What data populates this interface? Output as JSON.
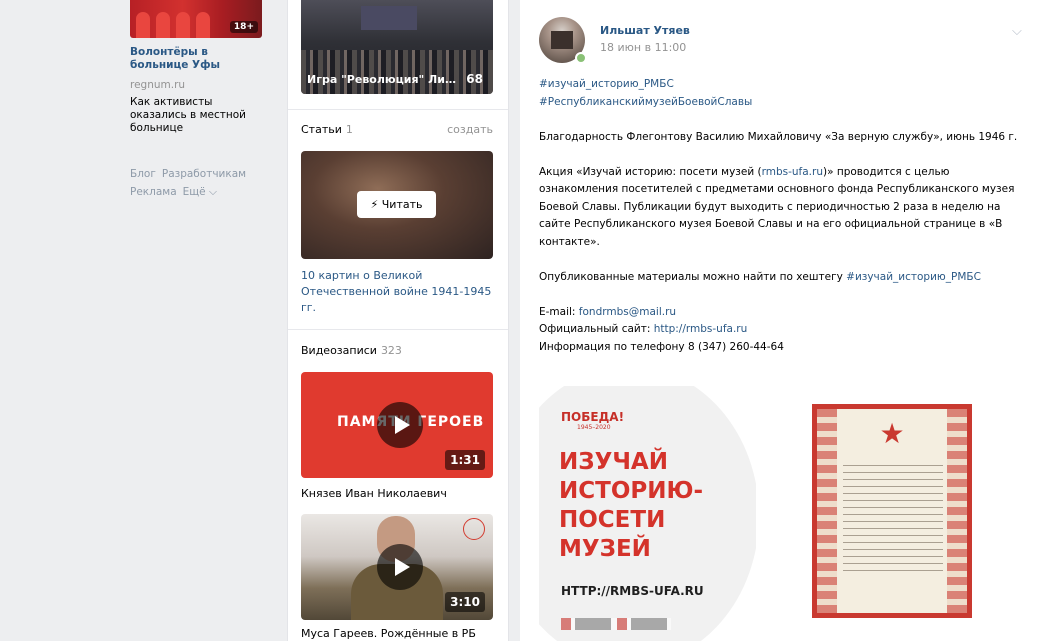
{
  "left": {
    "ad": {
      "badge": "18+",
      "title": "Волонтёры в больнице Уфы",
      "domain": "regnum.ru",
      "description": "Как активисты оказались в местной больнице"
    },
    "footer_links": [
      "Блог",
      "Разработчикам",
      "Реклама",
      "Ещё ⌵"
    ]
  },
  "middle": {
    "top_album": {
      "caption": "Игра \"Революция\" Лице...",
      "count": "68"
    },
    "articles": {
      "header": "Статьи",
      "count": "1",
      "action": "создать",
      "read_button": "Читать",
      "title": "10 картин о Великой Отечественной войне 1941-1945 гг."
    },
    "videos": {
      "header": "Видеозаписи",
      "count": "323",
      "items": [
        {
          "thumb_title": "ПАМЯТИ ГЕРОЕВ",
          "duration": "1:31",
          "title": "Князев Иван Николаевич"
        },
        {
          "duration": "3:10",
          "title": "Муса Гареев. Рождённые в РБ"
        }
      ]
    }
  },
  "post": {
    "author": "Ильшат Утяев",
    "date": "18 июн в 11:00",
    "hashtag1": "#изучай_историю_РМБС",
    "hashtag2": "#РеспубликанскиймузейБоевойСлавы",
    "para1": "Благодарность Флегонтову Василию Михайловичу «За верную службу», июнь 1946 г.",
    "para2_before": "Акция «Изучай историю: посети музей (",
    "para2_link": "rmbs-ufa.ru",
    "para2_after": ")» проводится с целью ознакомления посетителей с предметами основного фонда Республиканского музея Боевой Славы. Публикации будут выходить с периодичностью 2 раза в неделю на сайте Республиканского музея Боевой Славы и на его официальной странице в «В контакте».",
    "para3_before": "Опубликованные материалы можно найти по хештегу ",
    "para3_link": "#изучай_историю_РМБС",
    "email_label": "E-mail: ",
    "email": "fondrmbs@mail.ru",
    "site_label": "Официальный сайт: ",
    "site": "http://rmbs-ufa.ru",
    "phone": "Информация по телефону 8 (347) 260-44-64",
    "promo": {
      "pobeda": "ПОБЕДА!",
      "years": "1945–2020",
      "line1": "ИЗУЧАЙ",
      "line2": "ИСТОРИЮ-",
      "line3": "ПОСЕТИ",
      "line4": "МУЗЕЙ",
      "url": "HTTP://RMBS-UFA.RU"
    }
  }
}
